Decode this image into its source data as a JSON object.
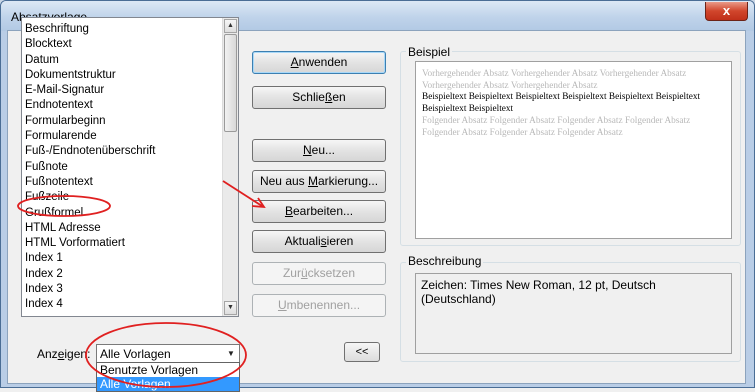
{
  "window": {
    "title": "Absatzvorlage",
    "close_glyph": "x"
  },
  "style_list": {
    "items": [
      "Beschriftung",
      "Blocktext",
      "Datum",
      "Dokumentstruktur",
      "E-Mail-Signatur",
      "Endnotentext",
      "Formularbeginn",
      "Formularende",
      "Fuß-/Endnotenüberschrift",
      "Fußnote",
      "Fußnotentext",
      "Fußzeile",
      "Grußformel",
      "HTML Adresse",
      "HTML Vorformatiert",
      "Index 1",
      "Index 2",
      "Index 3",
      "Index 4"
    ],
    "highlighted_item": "Fußnotentext"
  },
  "buttons": {
    "anwenden": {
      "pre": "",
      "key": "A",
      "post": "nwenden"
    },
    "schliessen": {
      "pre": "Schlie",
      "key": "ß",
      "post": "en"
    },
    "neu": {
      "pre": "",
      "key": "N",
      "post": "eu..."
    },
    "neu_aus_markierung": {
      "pre": "Neu aus ",
      "key": "M",
      "post": "arkierung..."
    },
    "bearbeiten": {
      "pre": "",
      "key": "B",
      "post": "earbeiten..."
    },
    "aktualisieren": {
      "pre": "Aktuali",
      "key": "s",
      "post": "ieren"
    },
    "zuruecksetzen": {
      "pre": "Zur",
      "key": "ü",
      "post": "cksetzen"
    },
    "umbenennen": {
      "pre": "",
      "key": "U",
      "post": "mbenennen..."
    },
    "collapse": "<<"
  },
  "preview": {
    "label": "Beispiel",
    "prev_text": "Vorhergehender Absatz Vorhergehender Absatz Vorhergehender Absatz Vorhergehender Absatz Vorhergehender Absatz",
    "sample_text": "Beispieltext Beispieltext Beispieltext Beispieltext Beispieltext Beispieltext Beispieltext Beispieltext",
    "next_text": "Folgender Absatz Folgender Absatz Folgender Absatz Folgender Absatz Folgender Absatz Folgender Absatz Folgender Absatz"
  },
  "description": {
    "label": "Beschreibung",
    "text": "Zeichen: Times New Roman, 12 pt, Deutsch (Deutschland)"
  },
  "show": {
    "label_pre": "Anz",
    "label_key": "e",
    "label_post": "igen:",
    "selected_value": "Alle Vorlagen",
    "options": [
      "Benutzte Vorlagen",
      "Alle Vorlagen"
    ],
    "highlighted_option": "Alle Vorlagen"
  },
  "annotation_color": "#e02020"
}
